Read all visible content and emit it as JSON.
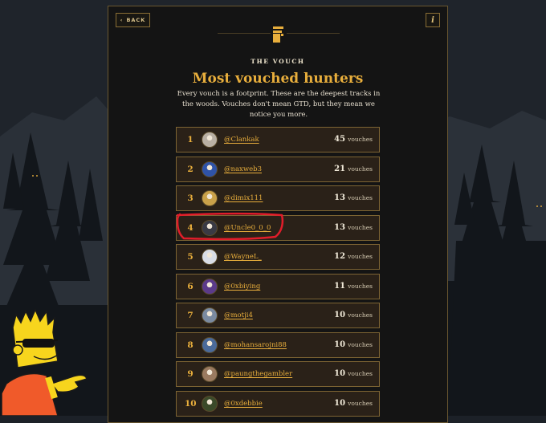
{
  "header": {
    "back_label": "BACK",
    "info_label": "i",
    "kicker": "THE VOUCH",
    "title": "Most vouched hunters",
    "subtitle": "Every vouch is a footprint. These are the deepest tracks in the woods. Vouches don't mean GTD, but they mean we notice you more."
  },
  "leaderboard": [
    {
      "rank": "1",
      "handle": "@Clankak",
      "count": "45",
      "unit": "vouches",
      "avatar_color": "#b9b0a4"
    },
    {
      "rank": "2",
      "handle": "@naxweb3",
      "count": "21",
      "unit": "vouches",
      "avatar_color": "#2f53a8"
    },
    {
      "rank": "3",
      "handle": "@dimix111",
      "count": "13",
      "unit": "vouches",
      "avatar_color": "#c9a14a"
    },
    {
      "rank": "4",
      "handle": "@Uncle0_0_0",
      "count": "13",
      "unit": "vouches",
      "avatar_color": "#3a3a44"
    },
    {
      "rank": "5",
      "handle": "@WayneL_",
      "count": "12",
      "unit": "vouches",
      "avatar_color": "#d9dde6"
    },
    {
      "rank": "6",
      "handle": "@0xbiying",
      "count": "11",
      "unit": "vouches",
      "avatar_color": "#5b3a8a"
    },
    {
      "rank": "7",
      "handle": "@motji4",
      "count": "10",
      "unit": "vouches",
      "avatar_color": "#7a8aa0"
    },
    {
      "rank": "8",
      "handle": "@mohansarojni88",
      "count": "10",
      "unit": "vouches",
      "avatar_color": "#4a6a9a"
    },
    {
      "rank": "9",
      "handle": "@paungthegambler",
      "count": "10",
      "unit": "vouches",
      "avatar_color": "#9a7a60"
    },
    {
      "rank": "10",
      "handle": "@0xdebbie",
      "count": "10",
      "unit": "vouches",
      "avatar_color": "#3b4a2a"
    }
  ],
  "colors": {
    "accent": "#e8ae3c",
    "panel": "#141414",
    "row_bg": "#2a2118",
    "row_border": "#7d6433",
    "highlight": "#e11d2a"
  },
  "icons": [
    "chevron-left-icon",
    "info-icon",
    "footprint-logo-icon",
    "bart-sticker"
  ]
}
